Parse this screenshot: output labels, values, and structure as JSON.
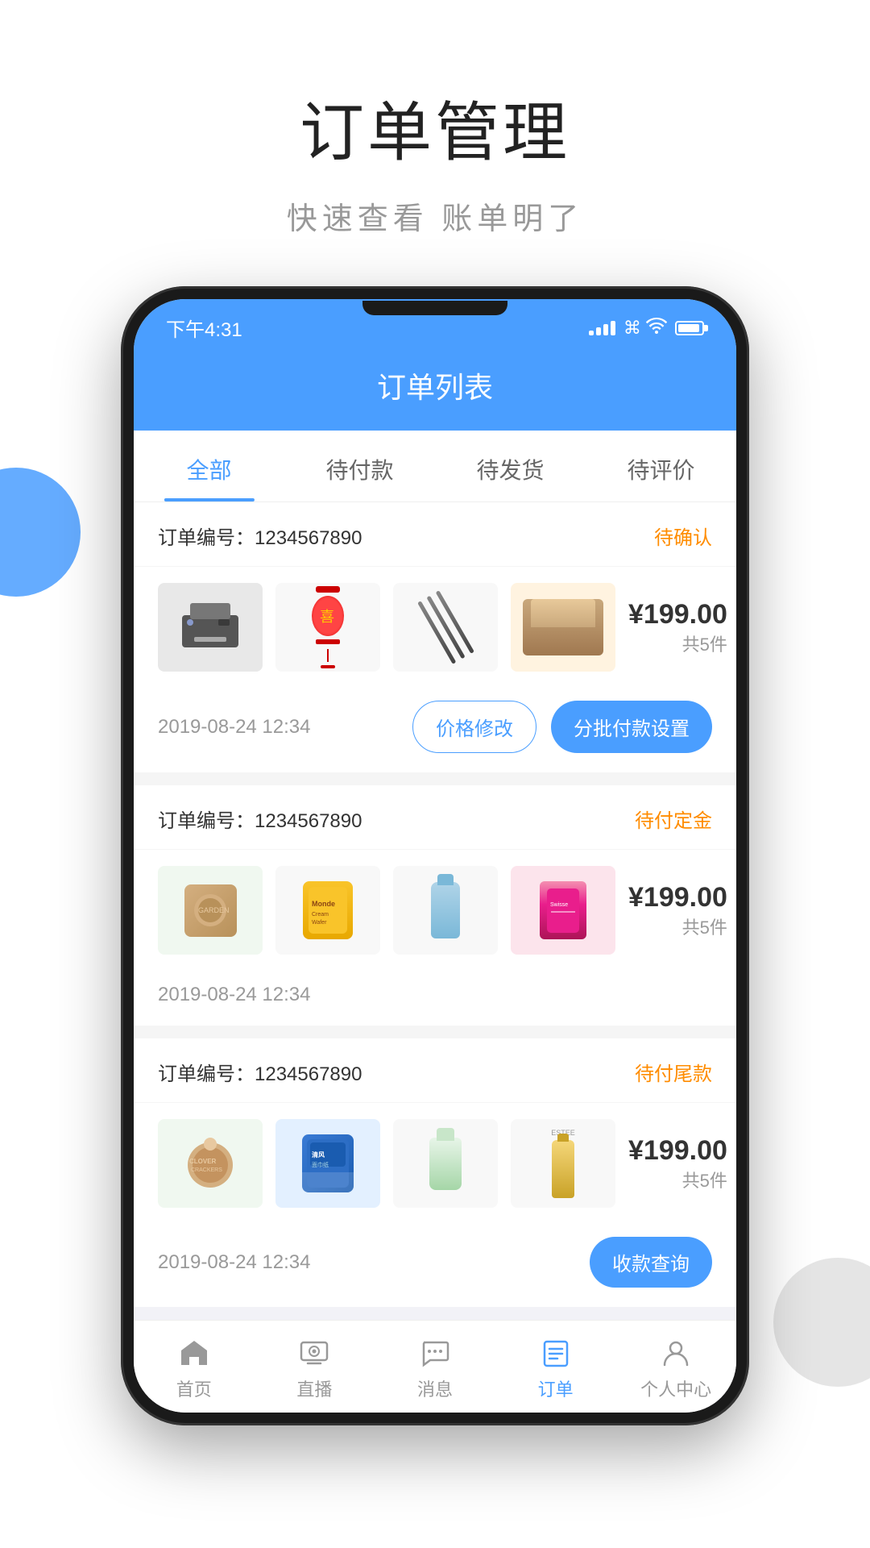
{
  "page": {
    "title": "订单管理",
    "subtitle": "快速查看 账单明了"
  },
  "phone": {
    "statusBar": {
      "time": "下午4:31"
    },
    "header": {
      "title": "订单列表"
    },
    "tabs": [
      {
        "label": "全部",
        "active": true
      },
      {
        "label": "待付款",
        "active": false
      },
      {
        "label": "待发货",
        "active": false
      },
      {
        "label": "待评价",
        "active": false
      }
    ],
    "orders": [
      {
        "id": "order-1",
        "number_label": "订单编号：",
        "number": "1234567890",
        "status": "待确认",
        "status_color": "orange",
        "price": "¥199.00",
        "count": "共5件",
        "date": "2019-08-24 12:34",
        "actions": [
          {
            "label": "价格修改",
            "type": "outline"
          },
          {
            "label": "分批付款设置",
            "type": "solid"
          }
        ]
      },
      {
        "id": "order-2",
        "number_label": "订单编号：",
        "number": "1234567890",
        "status": "待付定金",
        "status_color": "orange",
        "price": "¥199.00",
        "count": "共5件",
        "date": "2019-08-24 12:34",
        "actions": []
      },
      {
        "id": "order-3",
        "number_label": "订单编号：",
        "number": "1234567890",
        "status": "待付尾款",
        "status_color": "orange",
        "price": "¥199.00",
        "count": "共5件",
        "date": "2019-08-24 12:34",
        "actions": [
          {
            "label": "收款查询",
            "type": "solid"
          }
        ]
      }
    ],
    "bottomNav": [
      {
        "label": "首页",
        "icon": "home",
        "active": false
      },
      {
        "label": "直播",
        "icon": "tv",
        "active": false
      },
      {
        "label": "消息",
        "icon": "chat",
        "active": false
      },
      {
        "label": "订单",
        "icon": "list",
        "active": true
      },
      {
        "label": "个人中心",
        "icon": "person",
        "active": false
      }
    ]
  },
  "colors": {
    "primary": "#4A9EFF",
    "orange": "#FF8C00",
    "text_dark": "#333333",
    "text_gray": "#999999"
  }
}
